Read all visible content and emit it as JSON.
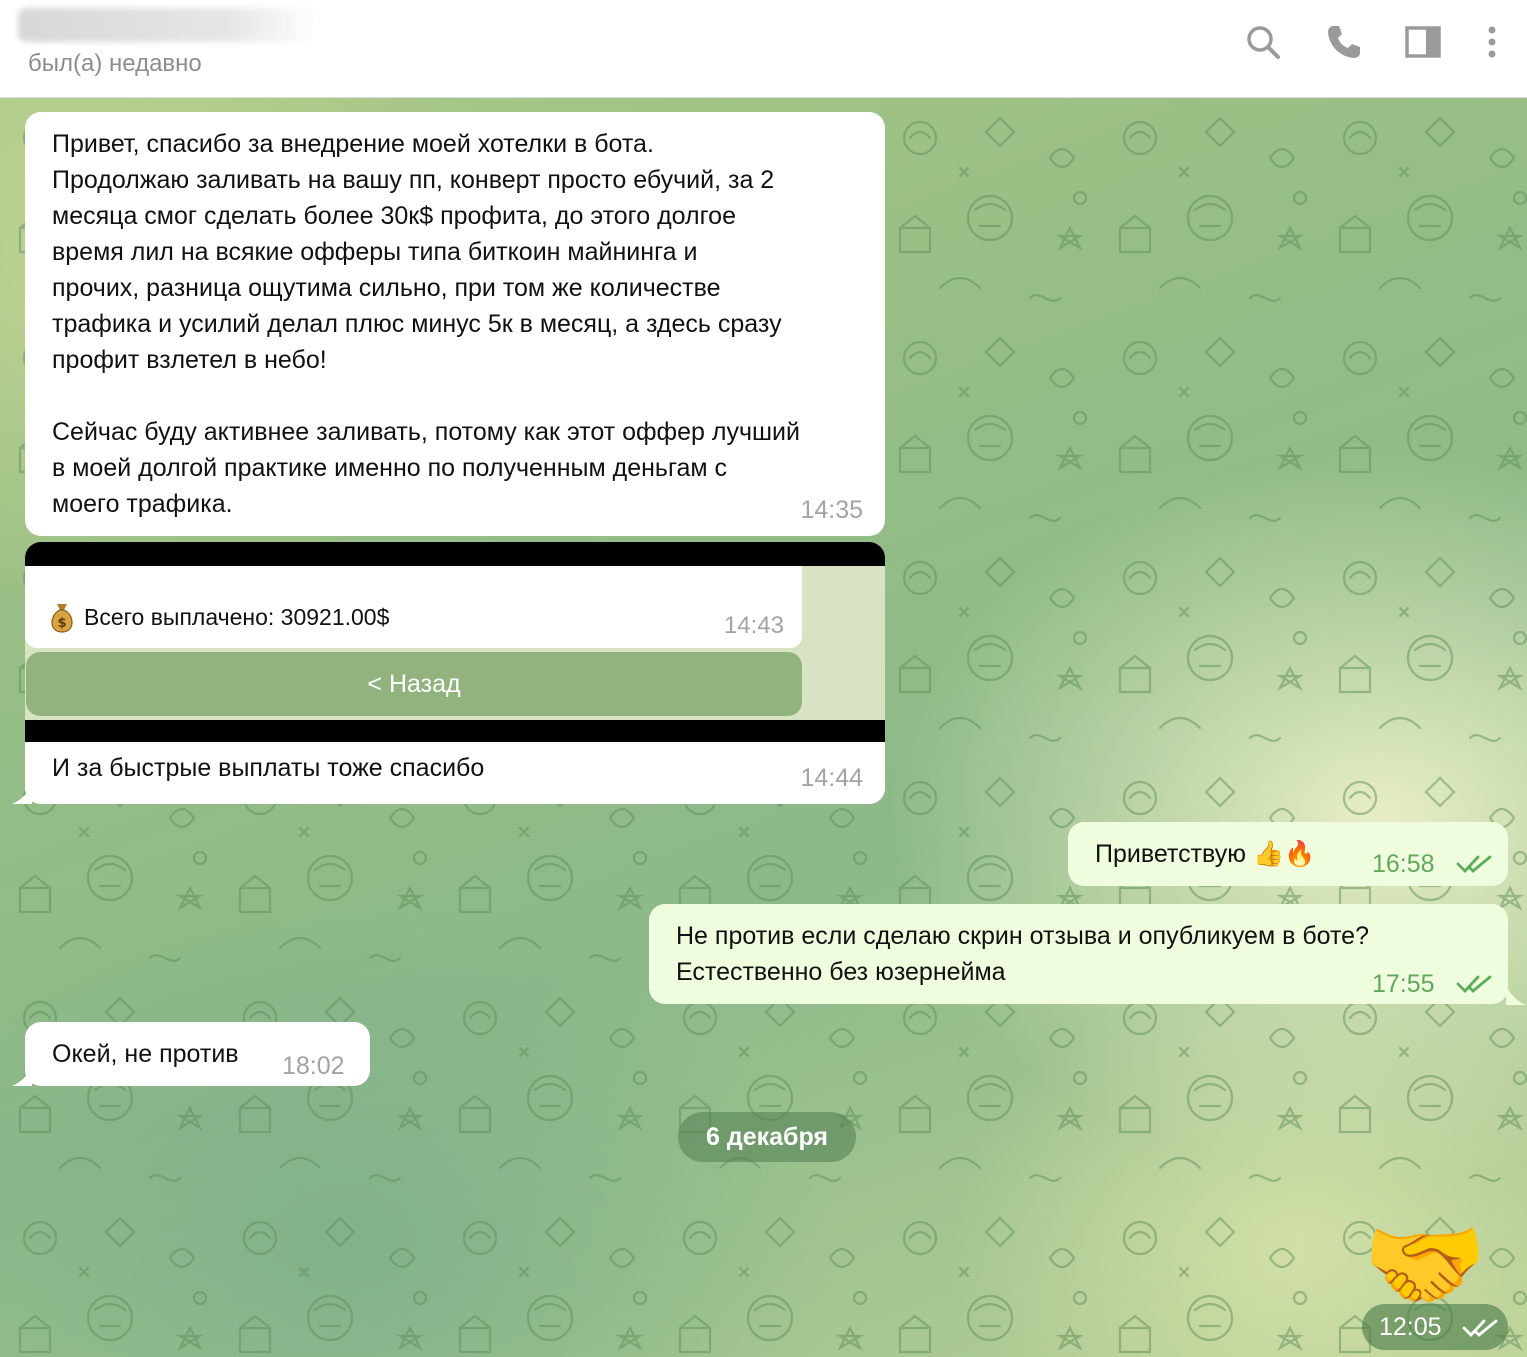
{
  "header": {
    "status": "был(а) недавно",
    "icons": [
      "search-icon",
      "phone-icon",
      "sidebar-toggle-icon",
      "more-vertical-icon"
    ]
  },
  "messages": {
    "m1": {
      "text": "Привет, спасибо за внедрение моей хотелки в бота.\nПродолжаю заливать на вашу пп, конверт просто ебучий, за 2\nмесяца смог сделать более 30к$ профита, до этого долгое\nвремя лил на всякие офферы типа биткоин майнинга и\nпрочих, разница ощутима сильно, при том же количестве\nтрафика и усилий делал плюс минус 5к в месяц, а здесь сразу\nпрофит взлетел в небо!\n\nСейчас буду активнее заливать, потому как этот оффер лучший\nв моей долгой практике именно по полученным деньгам с\nмоего трафика.",
      "time": "14:35"
    },
    "m2": {
      "text": "Всего выплачено: 30921.00$",
      "time": "14:43",
      "button": "< Назад",
      "icon": "money-bag-icon"
    },
    "m3": {
      "text": "И за быстрые выплаты тоже спасибо",
      "time": "14:44"
    },
    "m4": {
      "text": "Приветствую 👍🔥",
      "time": "16:58"
    },
    "m5": {
      "text": "Не против если сделаю скрин отзыва и опубликуем в боте?\nЕстественно без юзернейма",
      "time": "17:55"
    },
    "m6": {
      "text": "Окей, не против",
      "time": "18:02"
    },
    "date_separator": "6 декабря",
    "sticker": {
      "emoji": "🤝",
      "time": "12:05"
    }
  },
  "colors": {
    "incoming_bubble": "#ffffff",
    "outgoing_bubble": "#effdde",
    "outgoing_time": "#62a85a",
    "incoming_time": "#a3a3a3"
  }
}
